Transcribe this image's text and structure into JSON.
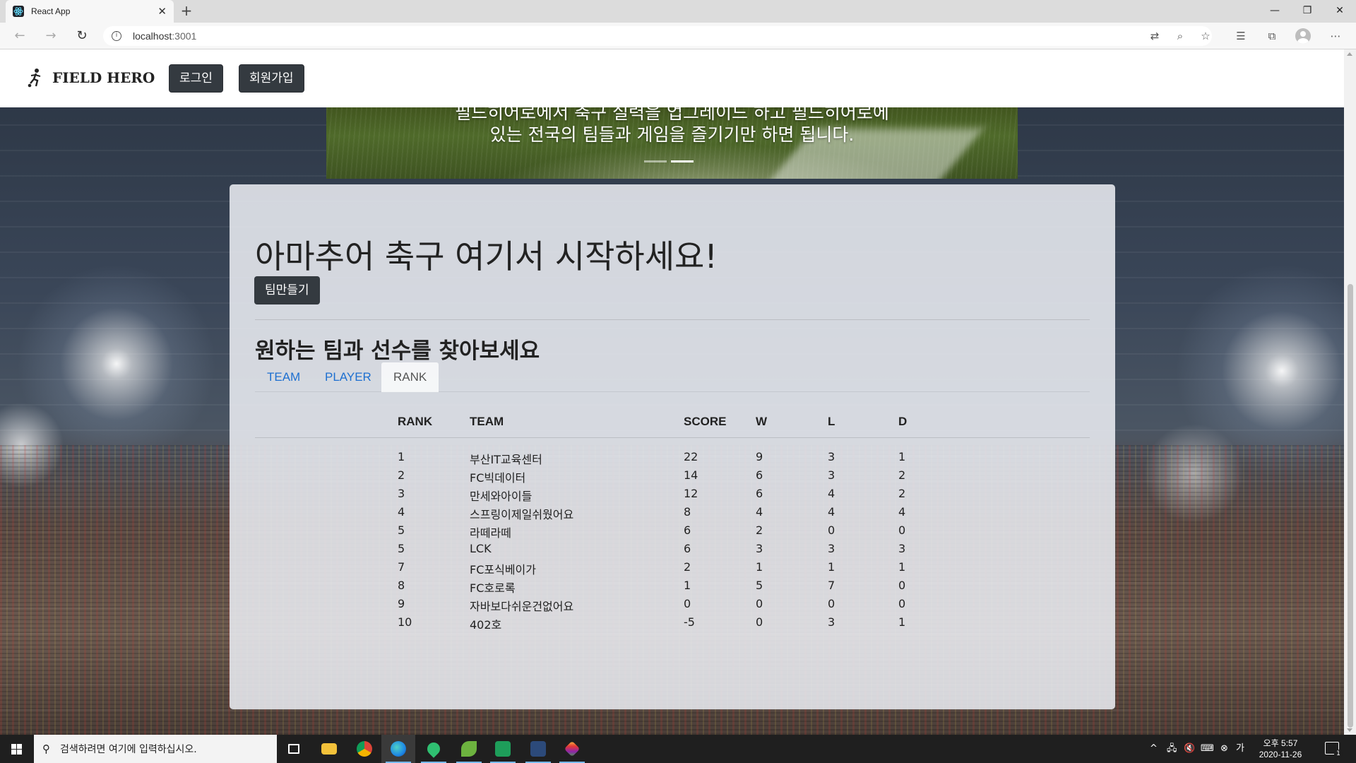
{
  "browser": {
    "tab_title": "React App",
    "url_host": "localhost",
    "url_port": ":3001"
  },
  "site": {
    "brand": "FIELD HERO",
    "nav": {
      "login": "로그인",
      "signup": "회원가입"
    },
    "carousel": {
      "caption_line1": "필드히어로에서 축구 실력을 업그레이드 하고 필드히어로에",
      "caption_line2": "있는 전국의 팀들과 게임을 즐기기만 하면 됩니다.",
      "active_slide": 2,
      "slide_count": 2
    },
    "jumbotron": {
      "title": "아마추어 축구 여기서 시작하세요!",
      "make_team": "팀만들기"
    },
    "search": {
      "title": "원하는 팀과 선수를 찾아보세요",
      "tabs": [
        {
          "label": "TEAM"
        },
        {
          "label": "PLAYER"
        },
        {
          "label": "RANK"
        }
      ],
      "active_tab": "RANK"
    },
    "rank_table": {
      "headers": {
        "rank": "RANK",
        "team": "TEAM",
        "score": "SCORE",
        "w": "W",
        "l": "L",
        "d": "D"
      },
      "rows": [
        {
          "rank": "1",
          "team": "부산IT교육센터",
          "score": "22",
          "w": "9",
          "l": "3",
          "d": "1"
        },
        {
          "rank": "2",
          "team": "FC빅데이터",
          "score": "14",
          "w": "6",
          "l": "3",
          "d": "2"
        },
        {
          "rank": "3",
          "team": "만세와아이들",
          "score": "12",
          "w": "6",
          "l": "4",
          "d": "2"
        },
        {
          "rank": "4",
          "team": "스프링이제일쉬웠어요",
          "score": "8",
          "w": "4",
          "l": "4",
          "d": "4"
        },
        {
          "rank": "5",
          "team": "라떼라떼",
          "score": "6",
          "w": "2",
          "l": "0",
          "d": "0"
        },
        {
          "rank": "5",
          "team": "LCK",
          "score": "6",
          "w": "3",
          "l": "3",
          "d": "3"
        },
        {
          "rank": "7",
          "team": "FC포식베이가",
          "score": "2",
          "w": "1",
          "l": "1",
          "d": "1"
        },
        {
          "rank": "8",
          "team": "FC호로록",
          "score": "1",
          "w": "5",
          "l": "7",
          "d": "0"
        },
        {
          "rank": "9",
          "team": "자바보다쉬운건없어요",
          "score": "0",
          "w": "0",
          "l": "0",
          "d": "0"
        },
        {
          "rank": "10",
          "team": "402호",
          "score": "-5",
          "w": "0",
          "l": "3",
          "d": "1"
        }
      ]
    }
  },
  "taskbar": {
    "search_placeholder": "검색하려면 여기에 입력하십시오.",
    "clock_time": "오후 5:57",
    "clock_date": "2020-11-26",
    "notification_count": "1"
  },
  "colors": {
    "dark_button": "#343a40",
    "link_blue": "#1d6fd0",
    "panel": "#e9ecf1"
  }
}
